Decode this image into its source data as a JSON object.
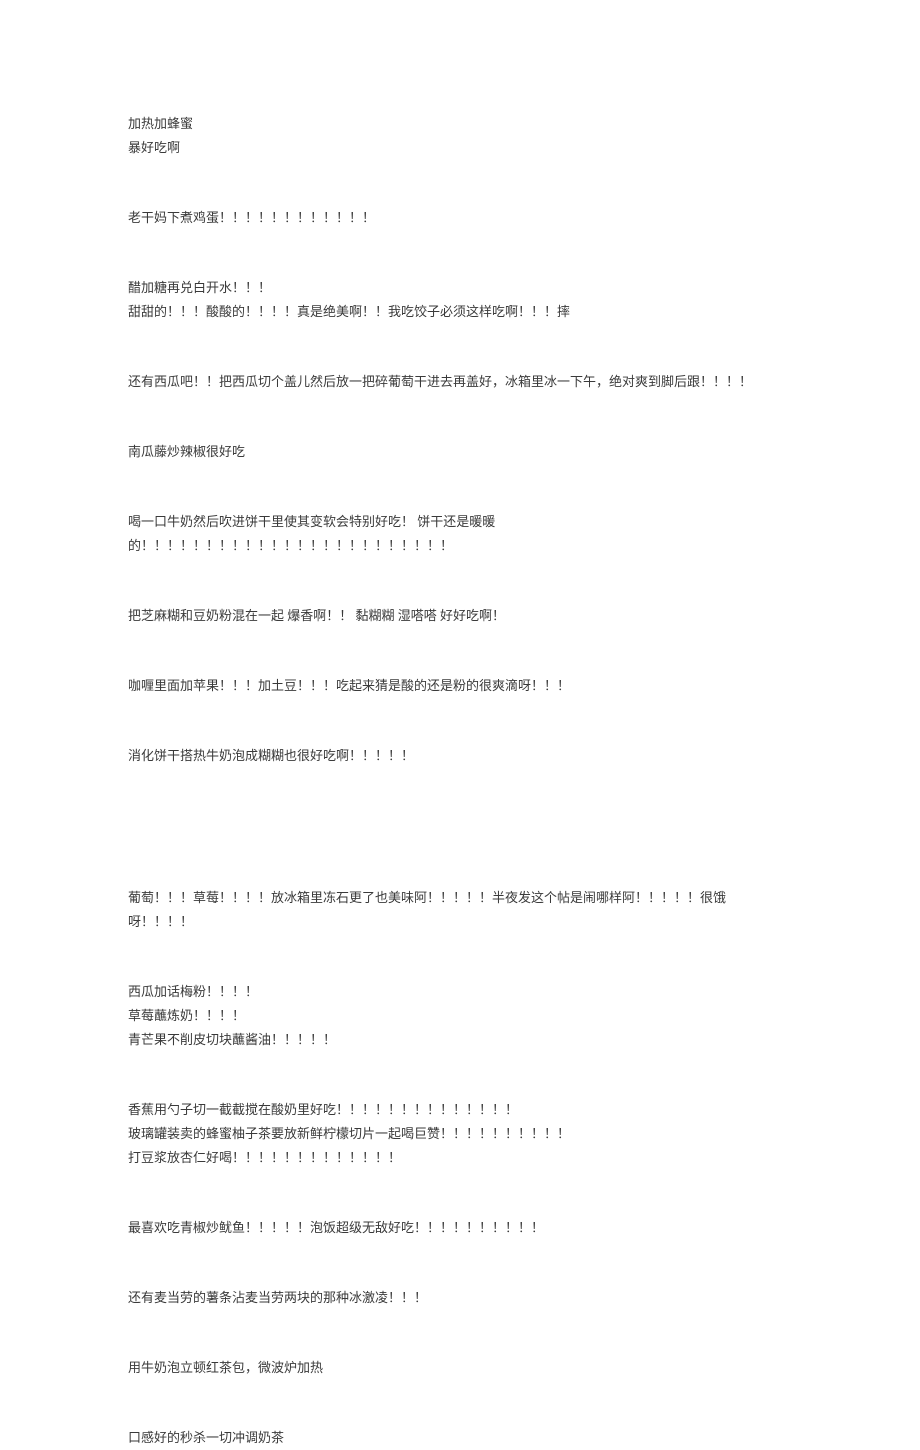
{
  "document": {
    "type": "forum-post-text",
    "language": "zh-CN",
    "text_color": "#3a3a3a",
    "background_color": "#ffffff",
    "blocks": [
      {
        "id": "b1",
        "gap_before": "none",
        "lines": [
          "加热加蜂蜜",
          "暴好吃啊"
        ]
      },
      {
        "id": "b2",
        "gap_before": "medium",
        "lines": [
          "老干妈下煮鸡蛋！！！！！！！！！！！！"
        ]
      },
      {
        "id": "b3",
        "gap_before": "large",
        "lines": [
          "醋加糖再兑白开水！！！",
          "甜甜的！！！酸酸的！！！！真是绝美啊！！我吃饺子必须这样吃啊！！！摔"
        ]
      },
      {
        "id": "b4",
        "gap_before": "medium",
        "lines": [
          "还有西瓜吧！！把西瓜切个盖儿然后放一把碎葡萄干进去再盖好，冰箱里冰一下午，绝对爽到脚后跟！！！！"
        ]
      },
      {
        "id": "b5",
        "gap_before": "medium",
        "lines": [
          "南瓜藤炒辣椒很好吃"
        ]
      },
      {
        "id": "b6",
        "gap_before": "medium",
        "lines": [
          "喝一口牛奶然后吹进饼干里使其变软会特别好吃！ 饼干还是暖暖的！！！！！！！！！！！！！！！！！！！！！！！！"
        ]
      },
      {
        "id": "b7",
        "gap_before": "medium",
        "lines": [
          "把芝麻糊和豆奶粉混在一起 爆香啊！！ 黏糊糊 湿嗒嗒 好好吃啊！"
        ]
      },
      {
        "id": "b8",
        "gap_before": "medium",
        "lines": [
          "咖喱里面加苹果！！！加土豆！！！吃起来猜是酸的还是粉的很爽滴呀！！！"
        ]
      },
      {
        "id": "b9",
        "gap_before": "medium",
        "lines": [
          "消化饼干搭热牛奶泡成糊糊也很好吃啊！！！！！"
        ]
      },
      {
        "id": "b10",
        "gap_before": "huge",
        "lines": [
          "葡萄！！！草莓！！！！放冰箱里冻石更了也美味阿！！！！！半夜发这个帖是闹哪样阿！！！！！很饿呀！！！！"
        ]
      },
      {
        "id": "b11",
        "gap_before": "medium",
        "lines": [
          "西瓜加话梅粉！！！！",
          "草莓蘸炼奶！！！！",
          "青芒果不削皮切块蘸酱油！！！！！"
        ]
      },
      {
        "id": "b12",
        "gap_before": "large",
        "lines": [
          "香蕉用勺子切一截截搅在酸奶里好吃！！！！！！！！！！！！！！",
          "玻璃罐装卖的蜂蜜柚子茶要放新鲜柠檬切片一起喝巨赞！！！！！！！！！！",
          "打豆浆放杏仁好喝！！！！！！！！！！！！！"
        ]
      },
      {
        "id": "b13",
        "gap_before": "medium",
        "lines": [
          "最喜欢吃青椒炒鱿鱼！！！！！泡饭超级无敌好吃！！！！！！！！！！"
        ]
      },
      {
        "id": "b14",
        "gap_before": "medium",
        "lines": [
          "还有麦当劳的薯条沾麦当劳两块的那种冰激凌！！！"
        ]
      },
      {
        "id": "b15",
        "gap_before": "medium",
        "lines": [
          "用牛奶泡立顿红茶包，微波炉加热"
        ]
      },
      {
        "id": "b16",
        "gap_before": "medium",
        "lines": [
          "口感好的秒杀一切冲调奶茶"
        ]
      }
    ]
  }
}
